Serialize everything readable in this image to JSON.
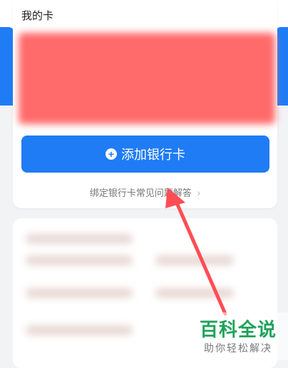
{
  "card": {
    "title": "我的卡"
  },
  "add_button": {
    "label": "添加银行卡"
  },
  "faq": {
    "label": "绑定银行卡常见问题解答"
  },
  "watermark": {
    "title": "百科全说",
    "subtitle": "助你轻松解决"
  },
  "colors": {
    "accent": "#1f7cf5",
    "card_blur": "#ff6b6b",
    "arrow": "#ff4d55",
    "watermark_green": "#1fa35a"
  },
  "icons": {
    "plus": "plus-circle-icon",
    "chevron": "chevron-right-icon"
  }
}
